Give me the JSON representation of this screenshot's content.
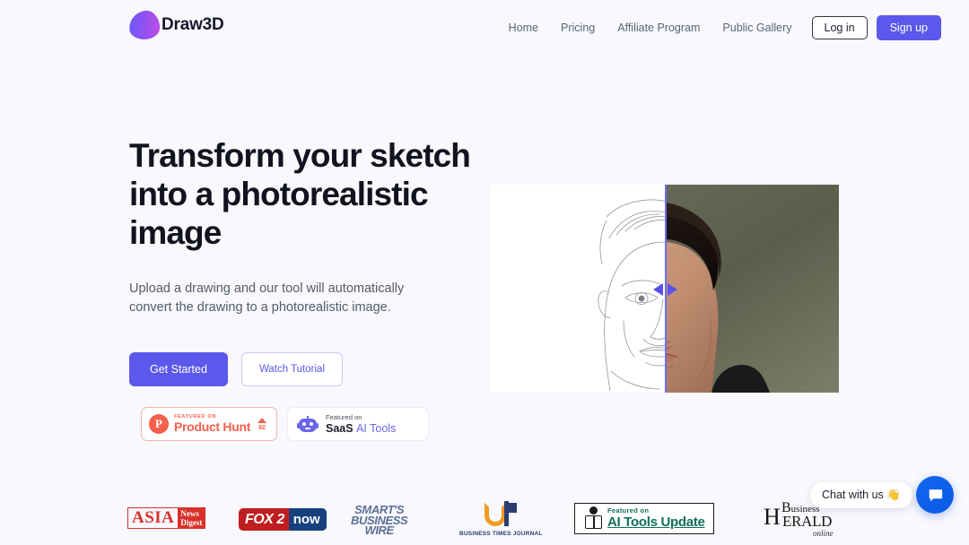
{
  "brand": {
    "name": "Draw3D",
    "mark_icon": "draw3d-blob-logo",
    "gradient_from": "#6a5af9",
    "gradient_to": "#c44ce8"
  },
  "nav": {
    "links": [
      {
        "label": "Home"
      },
      {
        "label": "Pricing"
      },
      {
        "label": "Affiliate Program"
      },
      {
        "label": "Public Gallery"
      }
    ],
    "login_label": "Log in",
    "signup_label": "Sign up",
    "accent": "#5b58eb"
  },
  "hero": {
    "title": "Transform your sketch into a photorealistic image",
    "subtitle": "Upload a drawing and our tool will automatically convert the drawing to a photorealistic image.",
    "primary_cta": "Get Started",
    "secondary_cta": "Watch Tutorial",
    "comparison": {
      "before_alt": "pencil sketch of a young man's face",
      "after_alt": "photorealistic portrait of a young man",
      "handle_icon": "left-right-arrows-slider-handle"
    }
  },
  "badges": {
    "product_hunt": {
      "small_label": "FEATURED ON",
      "name": "Product Hunt",
      "upvotes": "92",
      "logo_letter": "P",
      "color": "#f4604b"
    },
    "saas_ai_tools": {
      "small_label": "Featured on",
      "name_bold": "SaaS",
      "name_accent": "AI Tools",
      "icon": "robot-icon",
      "color": "#6b64e8"
    }
  },
  "press": {
    "asia": {
      "left": "ASIA",
      "right_top": "News",
      "right_bottom": "Digest"
    },
    "fox": {
      "left": "FOX 2",
      "right": "now"
    },
    "smart": {
      "line1": "SMART'S",
      "line2": "BUSINESS",
      "line3": "WIRE"
    },
    "business_times": {
      "label": "BUSINESS TIMES JOURNAL",
      "icon": "bt-monogram-icon"
    },
    "ai_tools_update": {
      "small": "Featured on",
      "name": "AI Tools Update",
      "icon": "person-box-icon"
    },
    "herald": {
      "b": "B",
      "usiness": "usiness",
      "h": "H",
      "erald": "ERALD",
      "online": "online"
    }
  },
  "chat": {
    "label": "Chat with us 👋",
    "button_icon": "chat-bubble-icon"
  }
}
